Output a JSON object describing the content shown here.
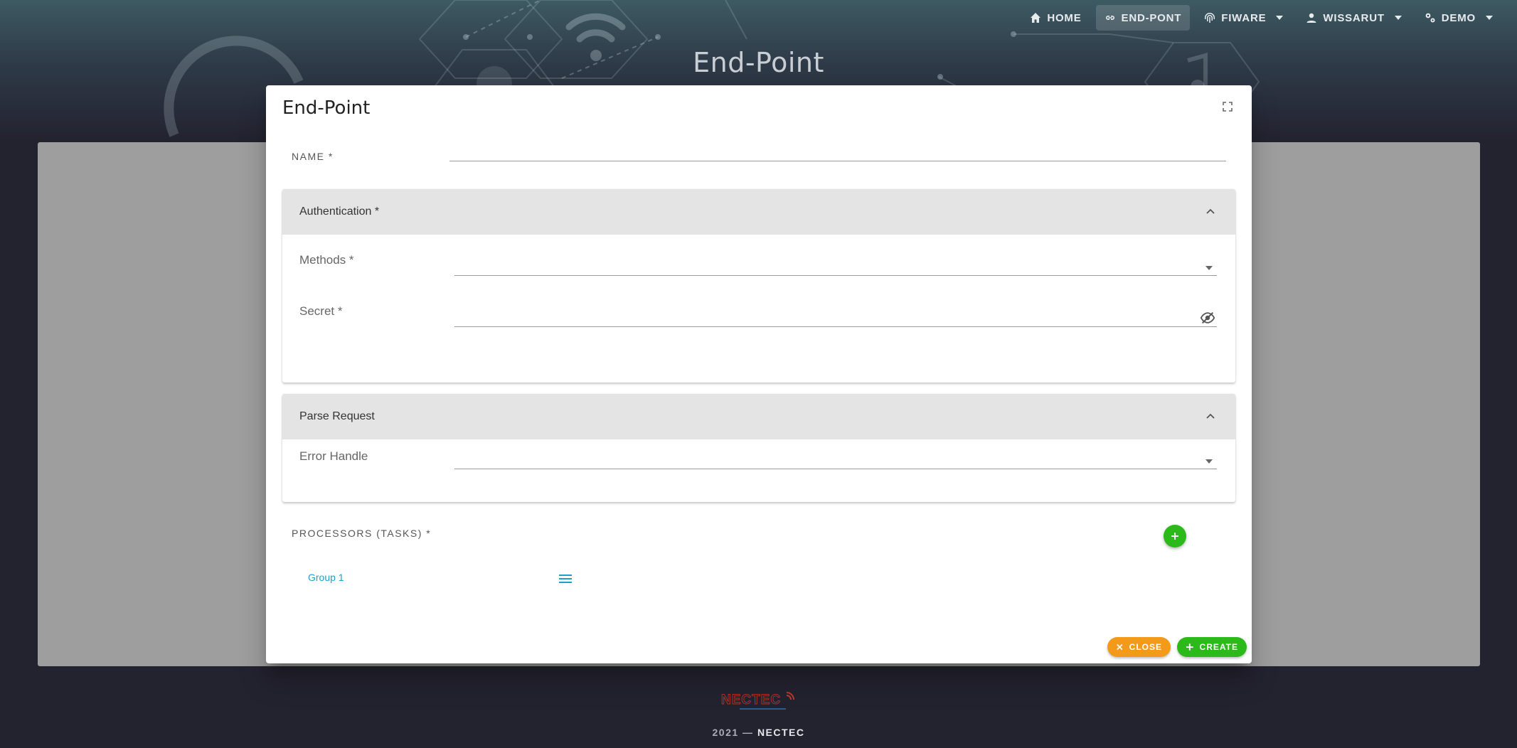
{
  "nav": {
    "home": "HOME",
    "endpoint": "END-PONT",
    "fiware": "FIWARE",
    "user": "WISSARUT",
    "demo": "DEMO"
  },
  "page": {
    "heading": "End-Point"
  },
  "dialog": {
    "title": "End-Point",
    "name_label": "NAME *",
    "name_value": "",
    "authentication": {
      "title": "Authentication *",
      "methods_label": "Methods *",
      "methods_value": "",
      "secret_label": "Secret *",
      "secret_value": ""
    },
    "parse_request": {
      "title": "Parse Request",
      "error_handle_label": "Error Handle",
      "error_handle_value": ""
    },
    "processors_label": "PROCESSORS (TASKS) *",
    "group_tab": "Group 1",
    "close_label": "CLOSE",
    "create_label": "CREATE"
  },
  "footer": {
    "year": "2021 —",
    "org": "NECTEC",
    "logo_text": "NECTEC"
  },
  "colors": {
    "accent_green": "#2cba1a",
    "accent_orange": "#f39a1b",
    "link_blue": "#1e9fcc"
  }
}
